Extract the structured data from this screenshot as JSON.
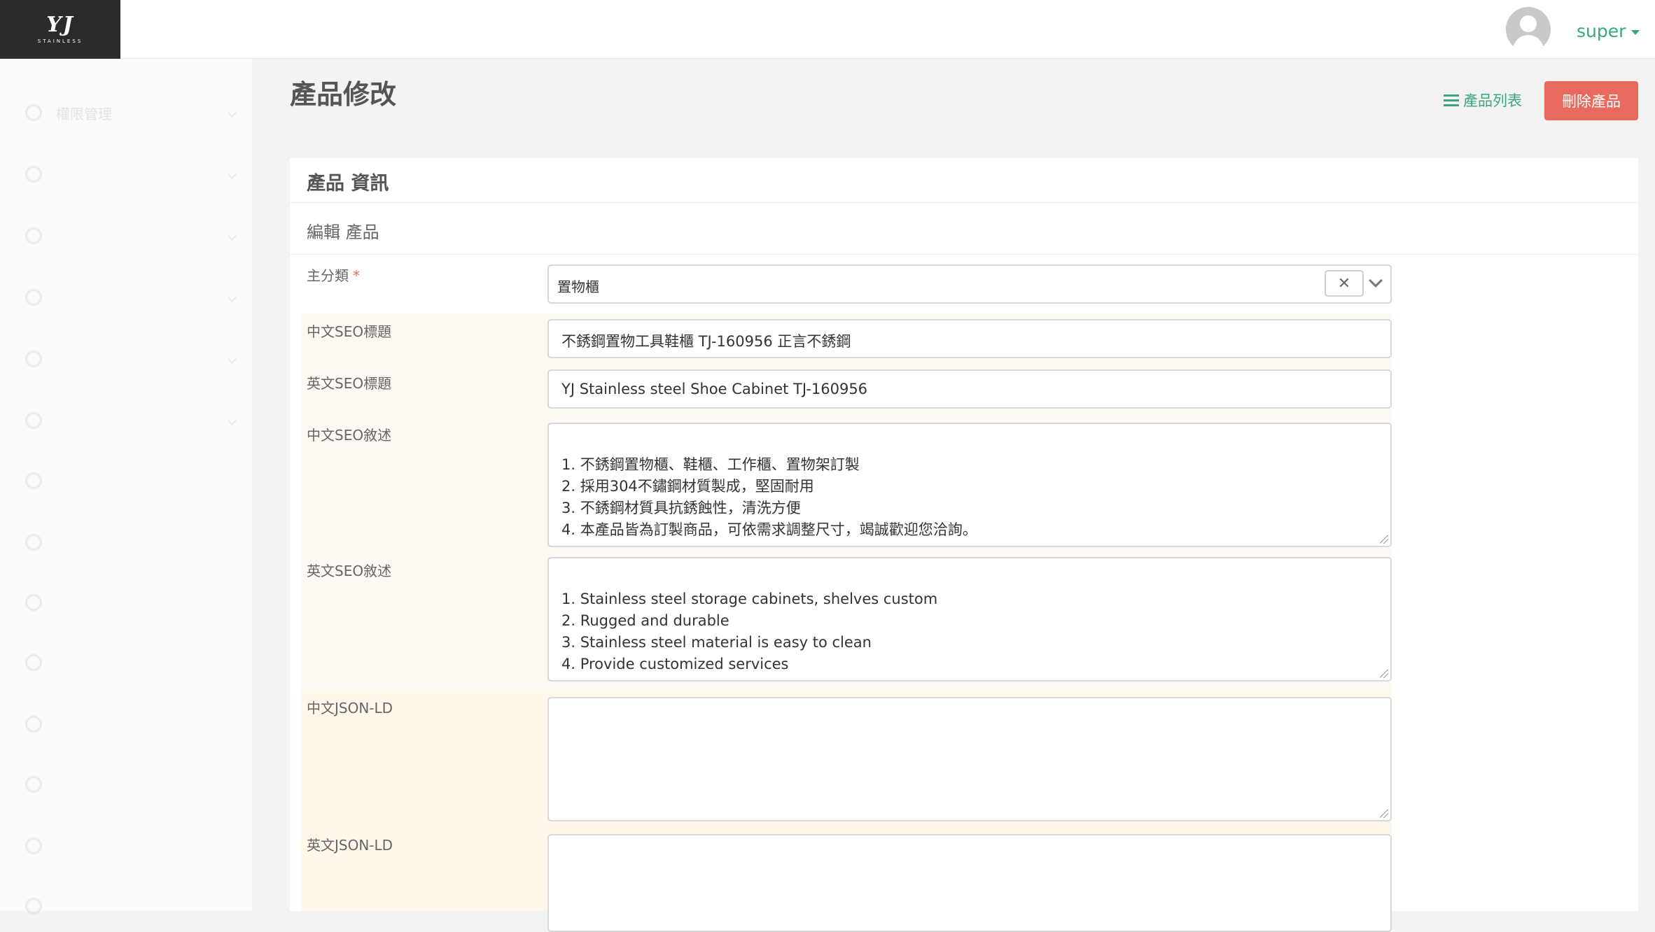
{
  "header": {
    "logo": {
      "mark": "YJ",
      "subtitle": "STAINLESS"
    },
    "user": {
      "name": "super"
    }
  },
  "page": {
    "title": "產品修改",
    "list_link": "產品列表",
    "delete_button": "刪除產品"
  },
  "sidebar": {
    "items": [
      {
        "label": "權限管理"
      },
      {
        "label": ""
      },
      {
        "label": ""
      },
      {
        "label": ""
      },
      {
        "label": ""
      },
      {
        "label": ""
      },
      {
        "label": ""
      },
      {
        "label": ""
      },
      {
        "label": ""
      },
      {
        "label": ""
      },
      {
        "label": ""
      },
      {
        "label": ""
      },
      {
        "label": ""
      },
      {
        "label": ""
      }
    ]
  },
  "panel": {
    "heading": "產品 資訊",
    "subheading": "編輯 產品"
  },
  "form": {
    "main_category": {
      "label": "主分類",
      "required": "*",
      "value": "置物櫃",
      "clear": "✕"
    },
    "seo_title_zh": {
      "label": "中文SEO標題",
      "value": "不銹鋼置物工具鞋櫃 TJ-160956 正言不銹鋼"
    },
    "seo_title_en": {
      "label": "英文SEO標題",
      "value": "YJ Stainless steel Shoe Cabinet TJ-160956"
    },
    "seo_desc_zh": {
      "label": "中文SEO敘述",
      "value": "1. 不銹鋼置物櫃、鞋櫃、工作櫃、置物架訂製\n2. 採用304不鏽鋼材質製成，堅固耐用\n3. 不銹鋼材質具抗銹蝕性，清洗方便\n4. 本產品皆為訂製商品，可依需求調整尺寸，竭誠歡迎您洽詢。"
    },
    "seo_desc_en": {
      "label": "英文SEO敘述",
      "value": "1. Stainless steel storage cabinets, shelves custom\n2. Rugged and durable\n3. Stainless steel material is easy to clean\n4. Provide customized services"
    },
    "jsonld_zh": {
      "label": "中文JSON-LD",
      "value": ""
    },
    "jsonld_en": {
      "label": "英文JSON-LD",
      "value": ""
    }
  }
}
